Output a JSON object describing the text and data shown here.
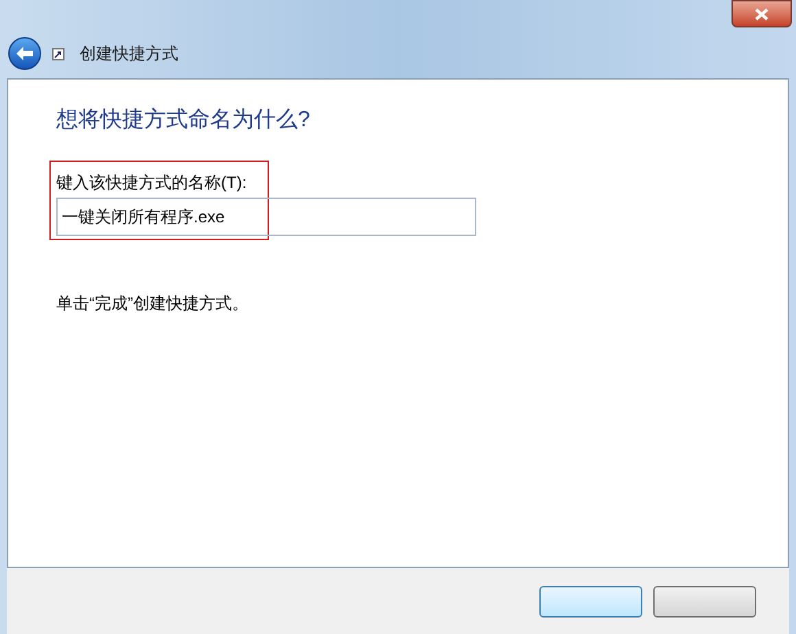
{
  "window": {
    "title": "创建快捷方式"
  },
  "heading": "想将快捷方式命名为什么?",
  "name_field": {
    "label": "键入该快捷方式的名称(T):",
    "value": "一键关闭所有程序.exe",
    "highlighted": true
  },
  "instruction": "单击“完成”创建快捷方式。"
}
